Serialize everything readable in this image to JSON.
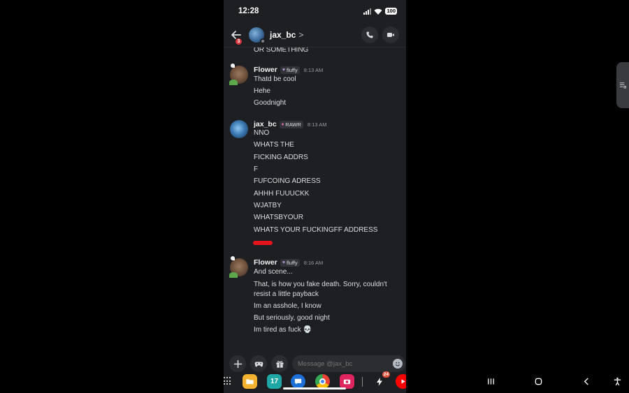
{
  "status_bar": {
    "time": "12:28",
    "battery": "100"
  },
  "header": {
    "back_badge": "3",
    "name": "jax_bc",
    "chevron": ">"
  },
  "messages": {
    "top_cut": "OR SOMETHING",
    "groups": [
      {
        "author": "Flower",
        "tag": "fluffy",
        "time": "8:13 AM",
        "lines": [
          "Thatd be cool",
          "Hehe",
          "Goodnight"
        ]
      },
      {
        "author": "jax_bc",
        "tag": "RAWR",
        "time": "8:13 AM",
        "lines": [
          "NNO",
          "WHATS THE",
          "FICKING ADDRS",
          "F",
          "FUFCOING ADRESS",
          "AHHH FUUUCKK",
          "WJATBY",
          "WHATSBYOUR",
          "WHATS YOUR FUCKINGFF ADDRESS"
        ]
      },
      {
        "author": "Flower",
        "tag": "fluffy",
        "time": "8:16 AM",
        "lines": [
          "And scene...",
          "That, is how you fake death. Sorry, couldn't resist a little payback",
          "Im an asshole, I know",
          "But seriously, good night",
          "Im tired as fuck 💀"
        ]
      }
    ]
  },
  "composer": {
    "placeholder": "Message @jax_bc"
  },
  "taskbar": {
    "calendar_day": "17",
    "bolt_badge": "24"
  },
  "colors": {
    "background": "#1e1f22",
    "text": "#dbdee1",
    "muted": "#949ba4",
    "spoiler": "#e4161b"
  }
}
